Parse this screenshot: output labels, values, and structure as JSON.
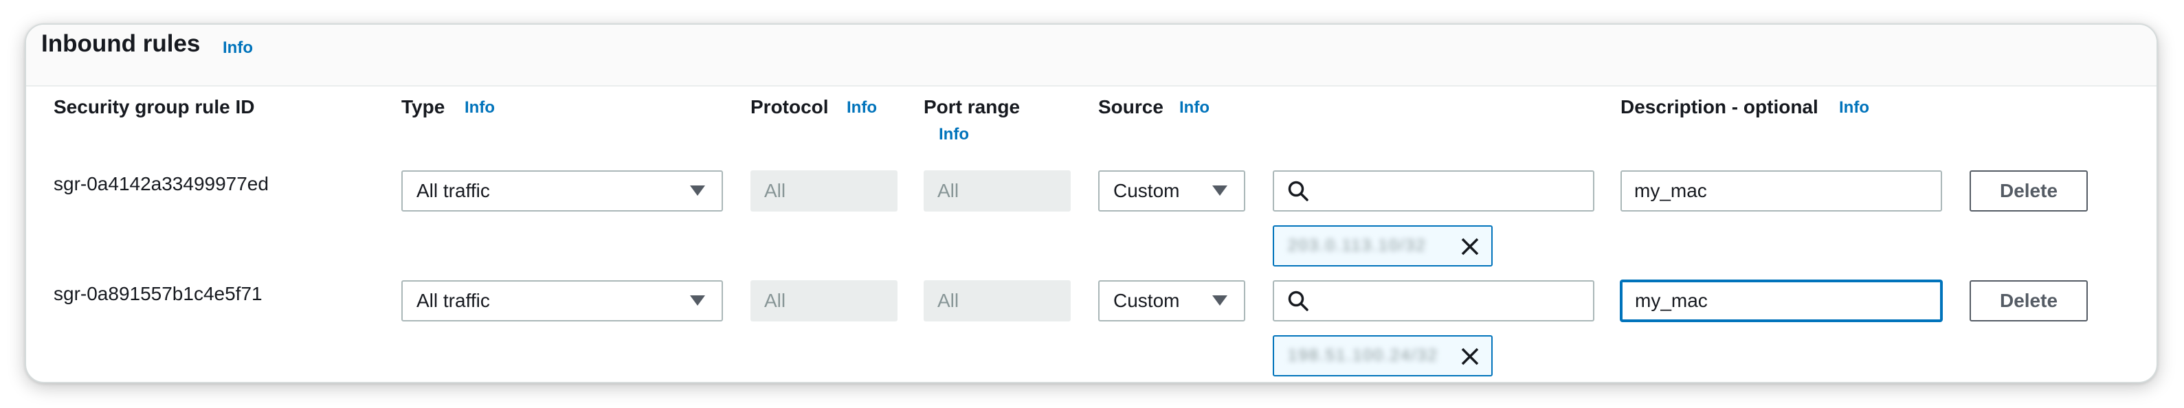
{
  "panel": {
    "title": "Inbound rules",
    "title_info": "Info"
  },
  "columns": {
    "rule_id": "Security group rule ID",
    "type": "Type",
    "type_info": "Info",
    "protocol": "Protocol",
    "protocol_info": "Info",
    "port_range": "Port range",
    "port_range_info": "Info",
    "source": "Source",
    "source_info": "Info",
    "description": "Description - optional",
    "description_info": "Info"
  },
  "rules": [
    {
      "id": "sgr-0a4142a33499977ed",
      "type": "All traffic",
      "protocol": "All",
      "port_range": "All",
      "source_mode": "Custom",
      "source_search_value": "",
      "source_token": "203.0.113.10/32",
      "description": "my_mac",
      "delete_label": "Delete"
    },
    {
      "id": "sgr-0a891557b1c4e5f71",
      "type": "All traffic",
      "protocol": "All",
      "port_range": "All",
      "source_mode": "Custom",
      "source_search_value": "",
      "source_token": "198.51.100.24/32",
      "description": "my_mac",
      "delete_label": "Delete"
    }
  ],
  "colors": {
    "link": "#0073bb",
    "border": "#aab7b8",
    "disabled_bg": "#eaeded",
    "token_bg": "#f1faff",
    "text": "#16191f"
  }
}
